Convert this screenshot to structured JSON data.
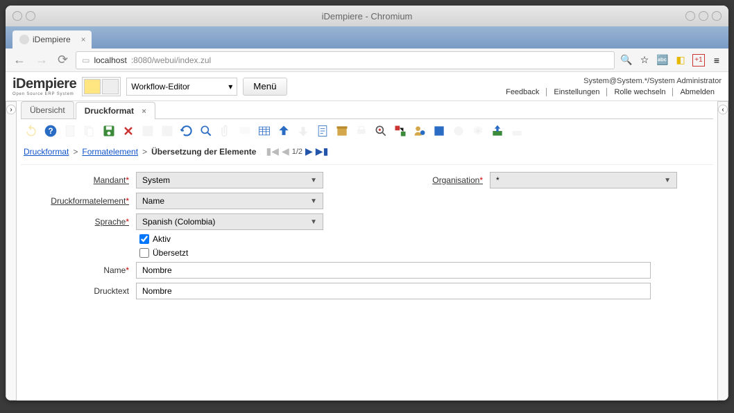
{
  "window_title": "iDempiere - Chromium",
  "browser_tab": "iDempiere",
  "url_host": "localhost",
  "url_port_path": ":8080/webui/index.zul",
  "logo_main": "iDempiere",
  "logo_sub": "Open Source ERP System",
  "workflow_selector": "Workflow-Editor",
  "menu_button": "Menü",
  "user_context": "System@System.*/System Administrator",
  "top_links": {
    "feedback": "Feedback",
    "settings": "Einstellungen",
    "change_role": "Rolle wechseln",
    "logout": "Abmelden"
  },
  "tabs": {
    "overview": "Übersicht",
    "druckformat": "Druckformat"
  },
  "breadcrumb": {
    "a": "Druckformat",
    "b": "Formatelement",
    "c": "Übersetzung der Elemente"
  },
  "pager_text": "1/2",
  "form": {
    "mandant_label": "Mandant",
    "mandant_value": "System",
    "organisation_label": "Organisation",
    "organisation_value": "*",
    "druckformatelement_label": "Druckformatelement",
    "druckformatelement_value": "Name",
    "sprache_label": "Sprache",
    "sprache_value": "Spanish (Colombia)",
    "aktiv_label": "Aktiv",
    "uebersetzt_label": "Übersetzt",
    "name_label": "Name",
    "name_value": "Nombre",
    "drucktext_label": "Drucktext",
    "drucktext_value": "Nombre"
  }
}
